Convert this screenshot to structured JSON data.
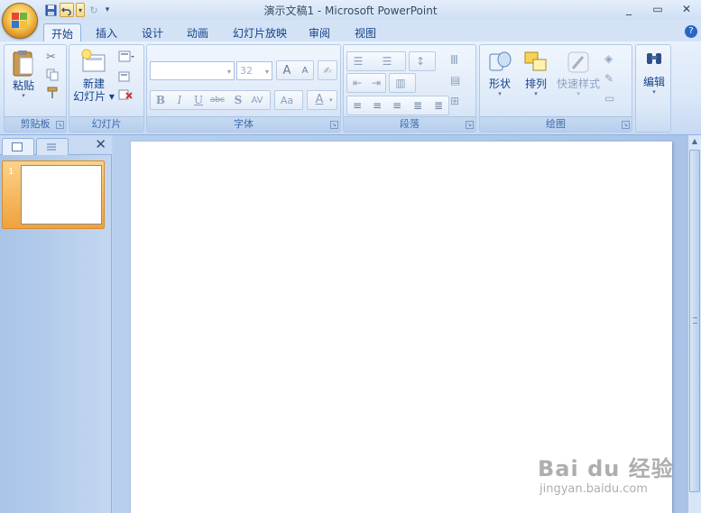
{
  "window": {
    "title": "演示文稿1 - Microsoft PowerPoint",
    "controls": [
      "_",
      "▭",
      "✕"
    ]
  },
  "tabs": [
    {
      "label": "开始",
      "active": true
    },
    {
      "label": "插入"
    },
    {
      "label": "设计"
    },
    {
      "label": "动画"
    },
    {
      "label": "幻灯片放映"
    },
    {
      "label": "审阅"
    },
    {
      "label": "视图"
    }
  ],
  "ribbon": {
    "clipboard": {
      "label": "剪贴板",
      "paste": "粘贴"
    },
    "slides": {
      "label": "幻灯片",
      "new_slide_line1": "新建",
      "new_slide_line2": "幻灯片"
    },
    "font": {
      "label": "字体",
      "size_value": "32",
      "bold": "B",
      "italic": "I",
      "underline": "U",
      "strike": "abc",
      "shadow": "S",
      "spacing": "AV",
      "case": "Aa",
      "color": "A",
      "grow": "A",
      "shrink": "A"
    },
    "paragraph": {
      "label": "段落"
    },
    "drawing": {
      "label": "绘图",
      "shapes": "形状",
      "arrange": "排列",
      "quick_styles": "快速样式"
    },
    "editing": {
      "label": "编辑"
    }
  },
  "slides_pane": {
    "slide_number": "1"
  },
  "watermark": {
    "main": "Bai du 经验",
    "sub": "jingyan.baidu.com"
  },
  "colors": {
    "accent": "#15428b",
    "ribbon_bg": "#dae7f8",
    "selected_slide": "#f0a23c"
  }
}
